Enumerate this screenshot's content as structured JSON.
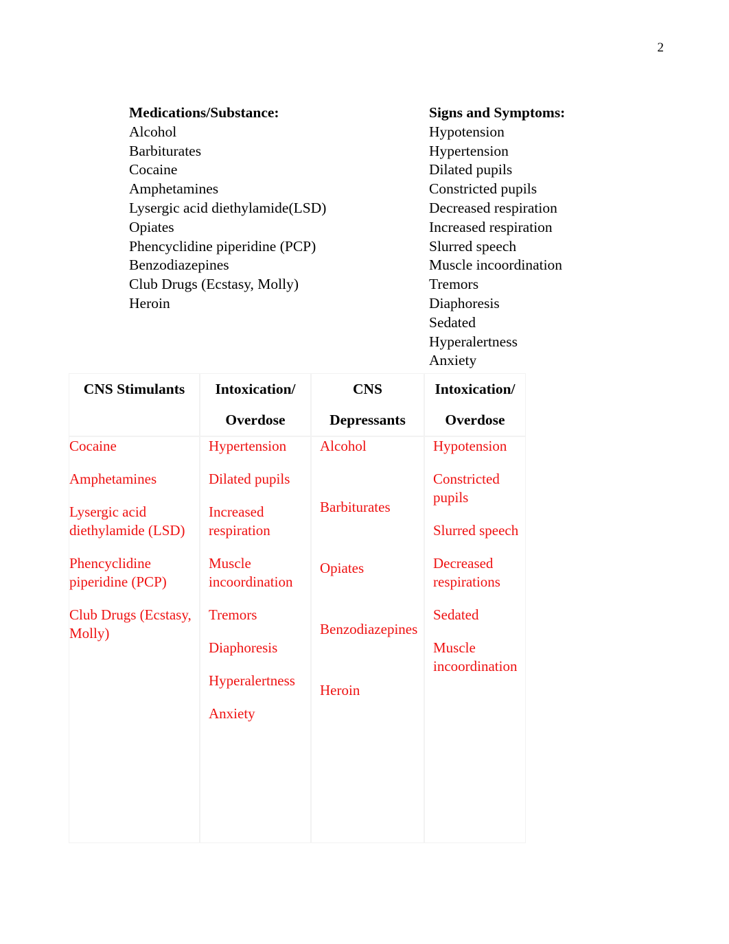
{
  "page": {
    "number": "2",
    "accent_red": "#ee1111",
    "text_black": "#000000",
    "border_gray": "#f2f2f2"
  },
  "lists": {
    "medications": {
      "heading": "Medications/Substance:",
      "items": [
        "Alcohol",
        "Barbiturates",
        "Cocaine",
        "Amphetamines",
        "Lysergic acid diethylamide(LSD)",
        "Opiates",
        "Phencyclidine piperidine (PCP)",
        "Benzodiazepines",
        "Club Drugs (Ecstasy, Molly)",
        "Heroin"
      ]
    },
    "signs": {
      "heading": "Signs and Symptoms:",
      "items": [
        "Hypotension",
        "Hypertension",
        "Dilated pupils",
        "Constricted pupils",
        "Decreased respiration",
        "Increased respiration",
        "Slurred speech",
        "Muscle incoordination",
        "Tremors",
        "Diaphoresis",
        "Sedated",
        "Hyperalertness",
        "Anxiety"
      ]
    }
  },
  "table": {
    "headers": [
      {
        "line1": "CNS Stimulants",
        "line2": ""
      },
      {
        "line1": "Intoxication/",
        "line2": "Overdose"
      },
      {
        "line1": "CNS",
        "line2": "Depressants"
      },
      {
        "line1": "Intoxication/",
        "line2": "Overdose"
      }
    ],
    "columns": {
      "cns_stimulants": [
        "Cocaine",
        "Amphetamines",
        "Lysergic acid diethylamide (LSD)",
        "Phencyclidine piperidine (PCP)",
        "Club Drugs (Ecstasy, Molly)"
      ],
      "stimulant_intoxication_overdose": [
        "Hypertension",
        "Dilated pupils",
        "Increased respiration",
        "Muscle incoordination",
        "Tremors",
        "Diaphoresis",
        "Hyperalertness",
        "Anxiety"
      ],
      "cns_depressants": [
        "Alcohol",
        "Barbiturates",
        "Opiates",
        "Benzodiazepines",
        "Heroin"
      ],
      "depressant_intoxication_overdose": [
        "Hypotension",
        "Constricted pupils",
        "Slurred speech",
        "Decreased respirations",
        "Sedated",
        "Muscle incoordination"
      ]
    }
  }
}
